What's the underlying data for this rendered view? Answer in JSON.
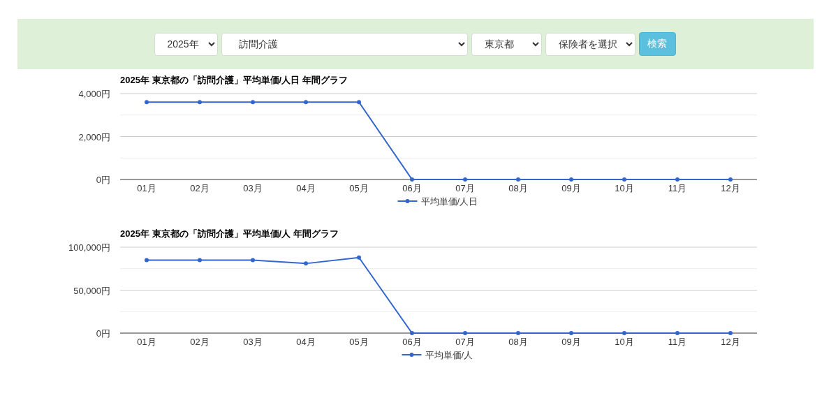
{
  "filters": {
    "year": "2025年",
    "service": "訪問介護",
    "prefecture": "東京都",
    "insurer_placeholder": "保険者を選択",
    "search_button": "検索"
  },
  "charts": [
    {
      "chart_data": {
        "type": "line",
        "title": "2025年 東京都の「訪問介護」平均単価/人日 年間グラフ",
        "categories": [
          "01月",
          "02月",
          "03月",
          "04月",
          "05月",
          "06月",
          "07月",
          "08月",
          "09月",
          "10月",
          "11月",
          "12月"
        ],
        "series": [
          {
            "name": "平均単価/人日",
            "color": "#3366cc",
            "marker": "circle",
            "values": [
              3600,
              3600,
              3600,
              3600,
              3600,
              0,
              0,
              0,
              0,
              0,
              0,
              0
            ]
          }
        ],
        "ylim": [
          0,
          4000
        ],
        "yticks": [
          {
            "value": 0,
            "label": "0円"
          },
          {
            "value": 2000,
            "label": "2,000円"
          },
          {
            "value": 4000,
            "label": "4,000円"
          }
        ],
        "ref_lines": [
          {
            "axis": "y",
            "value": 1000
          },
          {
            "axis": "y",
            "value": 3000
          }
        ]
      }
    },
    {
      "chart_data": {
        "type": "line",
        "title": "2025年 東京都の「訪問介護」平均単価/人 年間グラフ",
        "categories": [
          "01月",
          "02月",
          "03月",
          "04月",
          "05月",
          "06月",
          "07月",
          "08月",
          "09月",
          "10月",
          "11月",
          "12月"
        ],
        "series": [
          {
            "name": "平均単価/人",
            "color": "#3366cc",
            "marker": "circle",
            "values": [
              85000,
              85000,
              85000,
              81000,
              88000,
              0,
              0,
              0,
              0,
              0,
              0,
              0
            ]
          }
        ],
        "ylim": [
          0,
          100000
        ],
        "yticks": [
          {
            "value": 0,
            "label": "0円"
          },
          {
            "value": 50000,
            "label": "50,000円"
          },
          {
            "value": 100000,
            "label": "100,000円"
          }
        ],
        "ref_lines": [
          {
            "axis": "y",
            "value": 25000
          },
          {
            "axis": "y",
            "value": 75000
          }
        ]
      }
    }
  ]
}
